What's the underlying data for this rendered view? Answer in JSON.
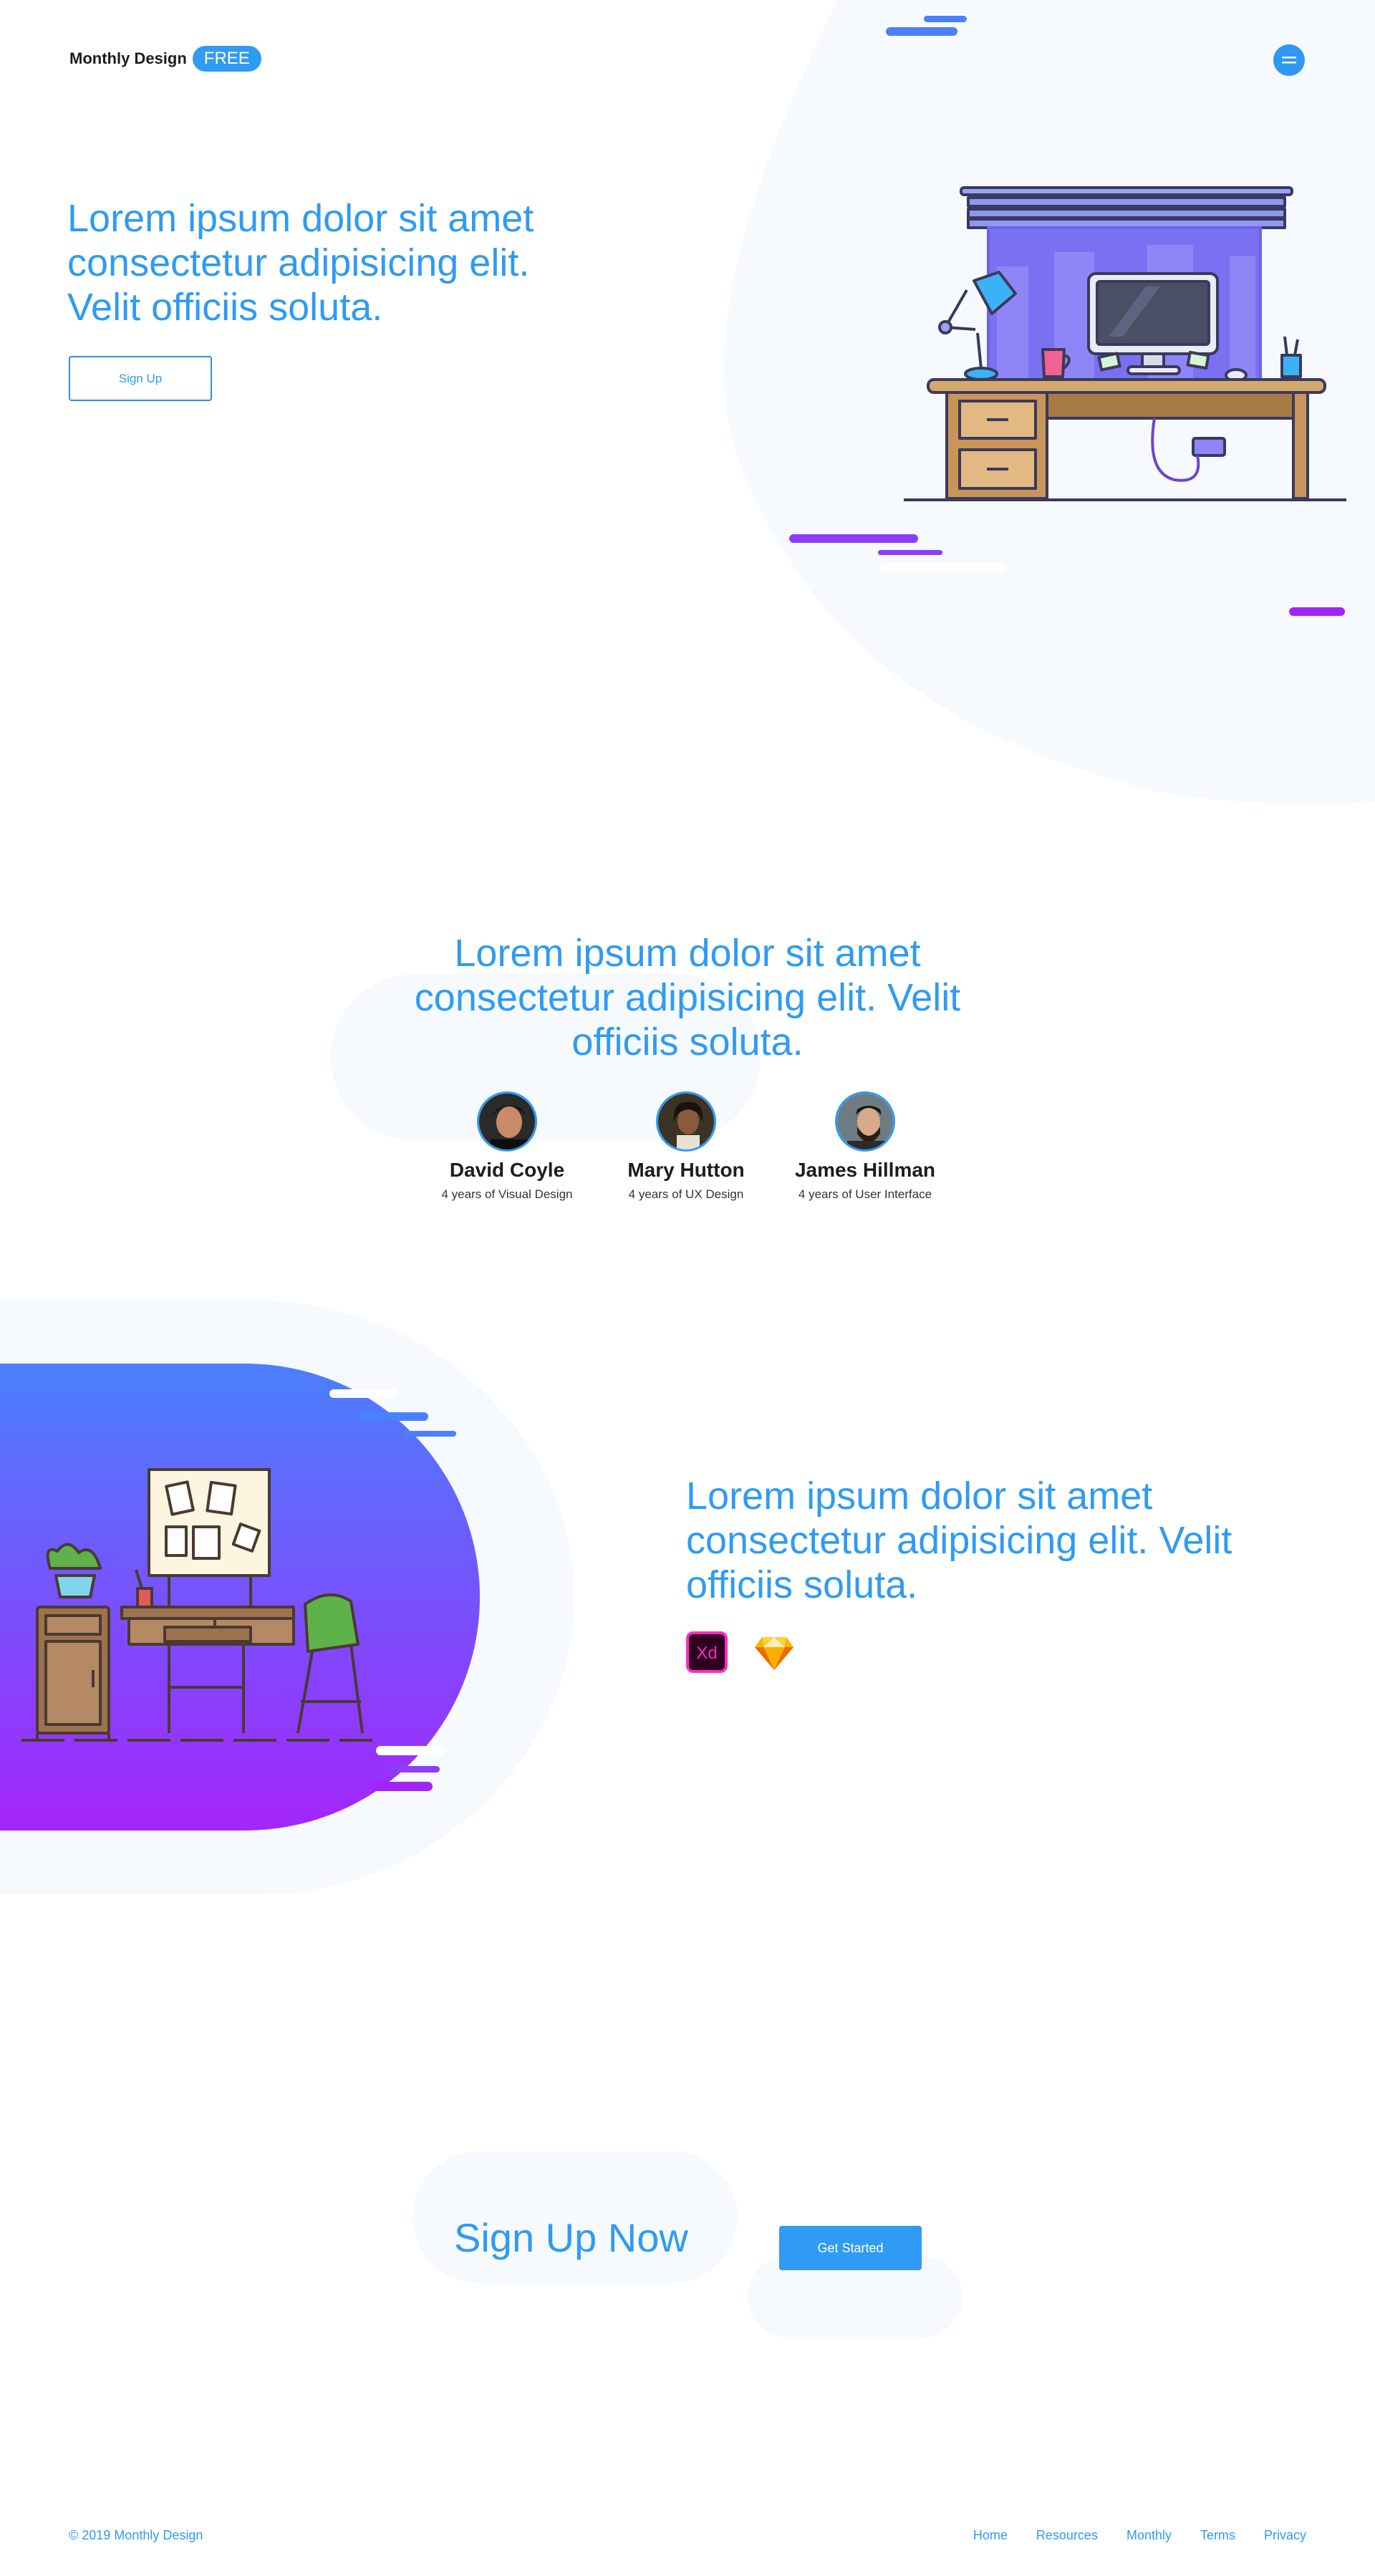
{
  "header": {
    "brand": "Monthly Design",
    "badge": "FREE"
  },
  "hero": {
    "title": "Lorem ipsum dolor sit amet consectetur adipisicing elit. Velit officiis soluta.",
    "signup_label": "Sign Up"
  },
  "team": {
    "title": "Lorem ipsum dolor sit amet consectetur adipisicing elit. Velit officiis soluta.",
    "members": [
      {
        "name": "David Coyle",
        "role": "4 years of Visual Design"
      },
      {
        "name": "Mary Hutton",
        "role": "4 years of UX Design"
      },
      {
        "name": "James Hillman",
        "role": "4 years of User Interface"
      }
    ]
  },
  "features": {
    "title": "Lorem ipsum dolor sit amet consectetur adipisicing elit. Velit officiis soluta.",
    "tools": [
      {
        "icon": "adobe-xd-icon",
        "label": "Xd"
      },
      {
        "icon": "sketch-icon"
      }
    ]
  },
  "cta": {
    "title": "Sign Up Now",
    "button_label": "Get Started"
  },
  "footer": {
    "copyright": "© 2019 Monthly Design",
    "links": [
      "Home",
      "Resources",
      "Monthly",
      "Terms",
      "Privacy"
    ]
  },
  "colors": {
    "accent": "#2f9bf2",
    "gradient_start": "#4a80fd",
    "gradient_end": "#a425fb",
    "pale_bg": "#f6f9fd"
  }
}
